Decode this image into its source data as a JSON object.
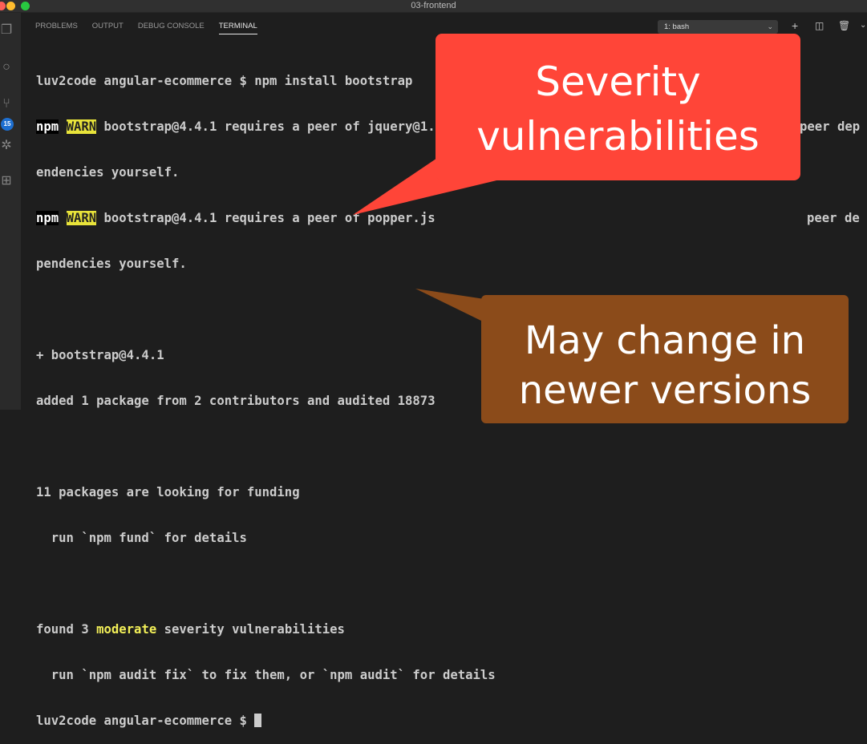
{
  "window": {
    "title": "03-frontend"
  },
  "activity_bar": {
    "scm_badge": "15"
  },
  "panel": {
    "tabs": [
      {
        "label": "PROBLEMS",
        "active": false
      },
      {
        "label": "OUTPUT",
        "active": false
      },
      {
        "label": "DEBUG CONSOLE",
        "active": false
      },
      {
        "label": "TERMINAL",
        "active": true
      }
    ],
    "terminal_select": "1: bash"
  },
  "terminal": {
    "l1": "luv2code angular-ecommerce $ npm install bootstrap",
    "npm": "npm",
    "warn": "WARN",
    "l2_rest": " bootstrap@4.4.1 requires a peer of jquery@1.",
    "l2_tail": "peer dep",
    "l3": "endencies yourself.",
    "l4_rest": " bootstrap@4.4.1 requires a peer of popper.js",
    "l4_tail": "peer de",
    "l5": "pendencies yourself.",
    "l7": "+ bootstrap@4.4.1",
    "l8": "added 1 package from 2 contributors and audited 18873",
    "l10": "11 packages are looking for funding",
    "l11": "  run `npm fund` for details",
    "l13_a": "found 3 ",
    "l13_mod": "moderate",
    "l13_b": " severity vulnerabilities",
    "l14": "  run `npm audit fix` to fix them, or `npm audit` for details",
    "l15": "luv2code angular-ecommerce $ "
  },
  "callouts": {
    "red_line1": "Severity",
    "red_line2": "vulnerabilities",
    "brown_line1": "May change in",
    "brown_line2": "newer versions",
    "red_color": "#ff4538",
    "brown_color": "#8b4b1a"
  }
}
